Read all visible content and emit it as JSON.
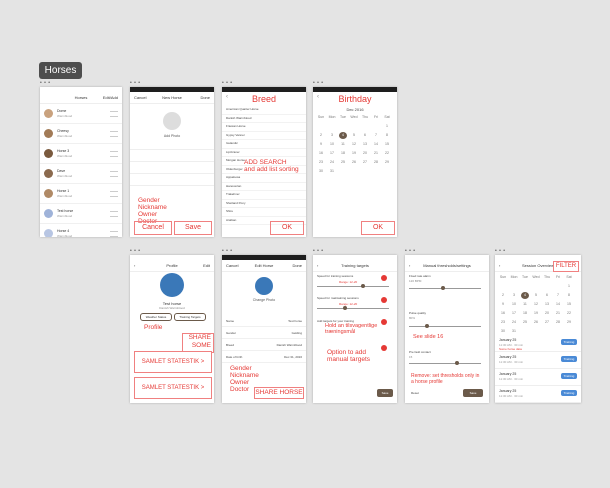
{
  "group_tag": "Horses",
  "dots": "• • •",
  "s1": {
    "title": "Horses",
    "edit": "Edit/Add",
    "items": [
      {
        "name": "Dome",
        "sub": "Warmblood"
      },
      {
        "name": "Cheesy",
        "sub": "Warmblood"
      },
      {
        "name": "Horse 3",
        "sub": "Warmblood"
      },
      {
        "name": "Dave",
        "sub": "Warmblood"
      },
      {
        "name": "Horse 1",
        "sub": "Warmblood"
      },
      {
        "name": "Test horse",
        "sub": "Warmblood"
      },
      {
        "name": "Horse 4",
        "sub": "Warmblood"
      }
    ]
  },
  "s2": {
    "cancel_top": "Cancel",
    "title": "New Horse",
    "save_top": "Done",
    "photo_label": "Add Photo",
    "notes": "Gender\nNickname\nOwner\nDoctor",
    "cancel": "Cancel",
    "save": "Save"
  },
  "s3": {
    "title": "Breed",
    "breeds": [
      "American Quarter Horse",
      "Danish Warmblood",
      "Friesian Horse",
      "Gypsy Vanner",
      "Icelandic",
      "Lipizzaner",
      "Morgan Horse",
      "Oldenburger",
      "Appaloosa",
      "Hanoverian",
      "Trakehner",
      "Shetland Pony",
      "Shire",
      "Arabian"
    ],
    "note": "ADD SEARCH\nand add list sorting",
    "ok": "OK"
  },
  "s4": {
    "title": "Birthday",
    "month": "Dec 2016",
    "days": [
      "Sun",
      "Mon",
      "Tue",
      "Wed",
      "Thu",
      "Fri",
      "Sat"
    ],
    "numbers": [
      "",
      "",
      "",
      "",
      "",
      "",
      "1",
      "2",
      "3",
      "4",
      "5",
      "6",
      "7",
      "8",
      "9",
      "10",
      "11",
      "12",
      "13",
      "14",
      "15",
      "16",
      "17",
      "18",
      "19",
      "20",
      "21",
      "22",
      "23",
      "24",
      "25",
      "26",
      "27",
      "28",
      "29",
      "30",
      "31"
    ],
    "ok": "OK"
  },
  "s5": {
    "title": "Profile",
    "edit": "Edit",
    "name": "Test horse",
    "sub": "Danish Warmblood",
    "btn1": "Weather Status",
    "btn2": "Training Targets",
    "profile_note": "Profile",
    "share": "SHARE\nSOME",
    "stats1": "SAMLET STATESTIK >",
    "stats2": "SAMLET STATESTIK >"
  },
  "s6": {
    "cancel_top": "Cancel",
    "title": "Edit Horse",
    "done": "Done",
    "photo_label": "Change Photo",
    "fields": [
      {
        "k": "Name",
        "v": "Test horse"
      },
      {
        "k": "Gender",
        "v": "Gelding"
      },
      {
        "k": "Breed",
        "v": "Danish Warmblood"
      },
      {
        "k": "Date of birth",
        "v": "Dec 31, 2016"
      }
    ],
    "notes": "Gender\nNickname\nOwner\nDoctor",
    "share": "SHARE HORSE"
  },
  "s7": {
    "title": "Training targets",
    "r1": "Speed for training sessions",
    "r1v": "Range: 12-20",
    "r2": "Speed for maintaining sessions",
    "r2v": "Range: 12-20",
    "r3": "Add targets for your training",
    "note1": "Hold an tilsvagentlige\ntræningsmål",
    "note2": "Option to add\nmanual targets",
    "save": "Save"
  },
  "s8": {
    "title": "Manual thresholds/settings",
    "r1": "Fixed rate alarm",
    "r1v": "120 BPM",
    "r2": "Pulse quality",
    "r2v": "80%",
    "r3": "Pre fault contact",
    "r3v": "15",
    "note1": "See slide 16",
    "note2": "Remove: set thresholds only in\na horse profile",
    "reset": "Reset",
    "save": "Save"
  },
  "s9": {
    "title": "Session Overview",
    "filter": "FILTER",
    "days": [
      "Sun",
      "Mon",
      "Tue",
      "Wed",
      "Thu",
      "Fri",
      "Sat"
    ],
    "numbers": [
      "",
      "",
      "",
      "",
      "",
      "",
      "1",
      "2",
      "3",
      "4",
      "5",
      "6",
      "7",
      "8",
      "9",
      "10",
      "11",
      "12",
      "13",
      "14",
      "15",
      "16",
      "17",
      "18",
      "19",
      "20",
      "21",
      "22",
      "23",
      "24",
      "25",
      "26",
      "27",
      "28",
      "29",
      "30",
      "31"
    ],
    "sessions": [
      {
        "date": "January 25",
        "time": "11:30 AM · 30 min",
        "extra": "Some horse data",
        "tag": "Training"
      },
      {
        "date": "January 25",
        "time": "11:30 AM · 30 min",
        "tag": "Training"
      },
      {
        "date": "January 25",
        "time": "11:30 AM · 30 min",
        "tag": "Training"
      },
      {
        "date": "January 25",
        "time": "11:30 AM · 30 min",
        "tag": "Training"
      }
    ]
  }
}
